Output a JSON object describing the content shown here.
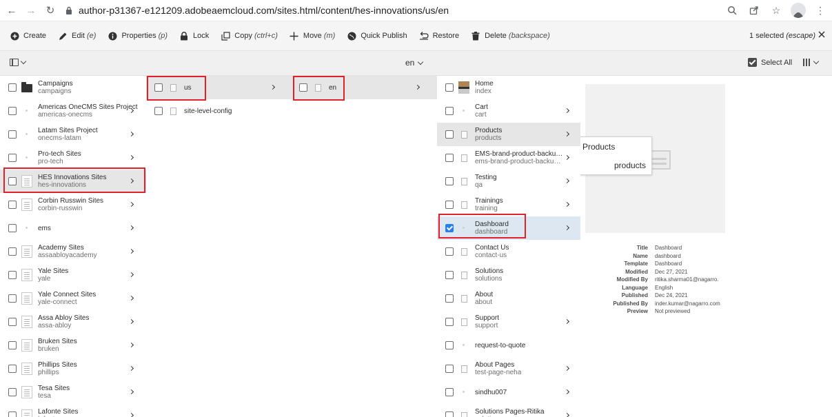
{
  "browser": {
    "url": "author-p31367-e121209.adobeaemcloud.com/sites.html/content/hes-innovations/us/en"
  },
  "actions": [
    {
      "label": "Create",
      "hint": "",
      "icon": "plus-circle-icon"
    },
    {
      "label": "Edit",
      "hint": "(e)",
      "icon": "pencil-icon"
    },
    {
      "label": "Properties",
      "hint": "(p)",
      "icon": "info-icon"
    },
    {
      "label": "Lock",
      "hint": "",
      "icon": "lock-icon"
    },
    {
      "label": "Copy",
      "hint": "(ctrl+c)",
      "icon": "copy-icon"
    },
    {
      "label": "Move",
      "hint": "(m)",
      "icon": "move-icon"
    },
    {
      "label": "Quick Publish",
      "hint": "",
      "icon": "globe-icon"
    },
    {
      "label": "Restore",
      "hint": "",
      "icon": "restore-icon"
    },
    {
      "label": "Delete",
      "hint": "(backspace)",
      "icon": "trash-icon"
    }
  ],
  "selection": {
    "label": "1 selected",
    "hint": "(escape)"
  },
  "subbar": {
    "language": "en",
    "select_all": "Select All"
  },
  "col1": [
    {
      "title": "Campaigns",
      "name": "campaigns"
    },
    {
      "title": "Americas OneCMS Sites Project",
      "name": "americas-onecms"
    },
    {
      "title": "Latam Sites Project",
      "name": "onecms-latam"
    },
    {
      "title": "Pro-tech Sites",
      "name": "pro-tech"
    },
    {
      "title": "HES Innovations Sites",
      "name": "hes-innovations"
    },
    {
      "title": "Corbin Russwin Sites",
      "name": "corbin-russwin"
    },
    {
      "title": "ems",
      "name": ""
    },
    {
      "title": "Academy Sites",
      "name": "assaabloyacademy"
    },
    {
      "title": "Yale Sites",
      "name": "yale"
    },
    {
      "title": "Yale Connect Sites",
      "name": "yale-connect"
    },
    {
      "title": "Assa Abloy Sites",
      "name": "assa-abloy"
    },
    {
      "title": "Bruken Sites",
      "name": "bruken"
    },
    {
      "title": "Phillips Sites",
      "name": "phillips"
    },
    {
      "title": "Tesa Sites",
      "name": "tesa"
    },
    {
      "title": "Lafonte Sites",
      "name": "lafonte"
    }
  ],
  "col2": [
    {
      "title": "us"
    },
    {
      "title": "site-level-config"
    }
  ],
  "col3": [
    {
      "title": "en"
    }
  ],
  "col4": [
    {
      "title": "Home",
      "name": "index"
    },
    {
      "title": "Cart",
      "name": "cart"
    },
    {
      "title": "Products",
      "name": "products"
    },
    {
      "title": "EMS-brand-product-backup-...",
      "name": "ems-brand-product-backup-n..."
    },
    {
      "title": "Testing",
      "name": "qa"
    },
    {
      "title": "Trainings",
      "name": "training"
    },
    {
      "title": "Dashboard",
      "name": "dashboard"
    },
    {
      "title": "Contact Us",
      "name": "contact-us"
    },
    {
      "title": "Solutions",
      "name": "solutions"
    },
    {
      "title": "About",
      "name": "about"
    },
    {
      "title": "Support",
      "name": "support"
    },
    {
      "title": "request-to-quote",
      "name": ""
    },
    {
      "title": "About Pages",
      "name": "test-page-neha"
    },
    {
      "title": "sindhu007",
      "name": ""
    },
    {
      "title": "Solutions Pages-Ritika",
      "name": "solutions-pages"
    }
  ],
  "tooltip": {
    "title": "Products",
    "name": "products"
  },
  "meta": [
    {
      "k": "Title",
      "v": "Dashboard"
    },
    {
      "k": "Name",
      "v": "dashboard"
    },
    {
      "k": "Template",
      "v": "Dashboard"
    },
    {
      "k": "Modified",
      "v": "Dec 27, 2021"
    },
    {
      "k": "Modified By",
      "v": "ritika.sharma01@nagarro."
    },
    {
      "k": "Language",
      "v": "English"
    },
    {
      "k": "Published",
      "v": "Dec 24, 2021"
    },
    {
      "k": "Published By",
      "v": "inder.kumar@nagarro.com"
    },
    {
      "k": "Preview",
      "v": "Not previewed"
    }
  ]
}
